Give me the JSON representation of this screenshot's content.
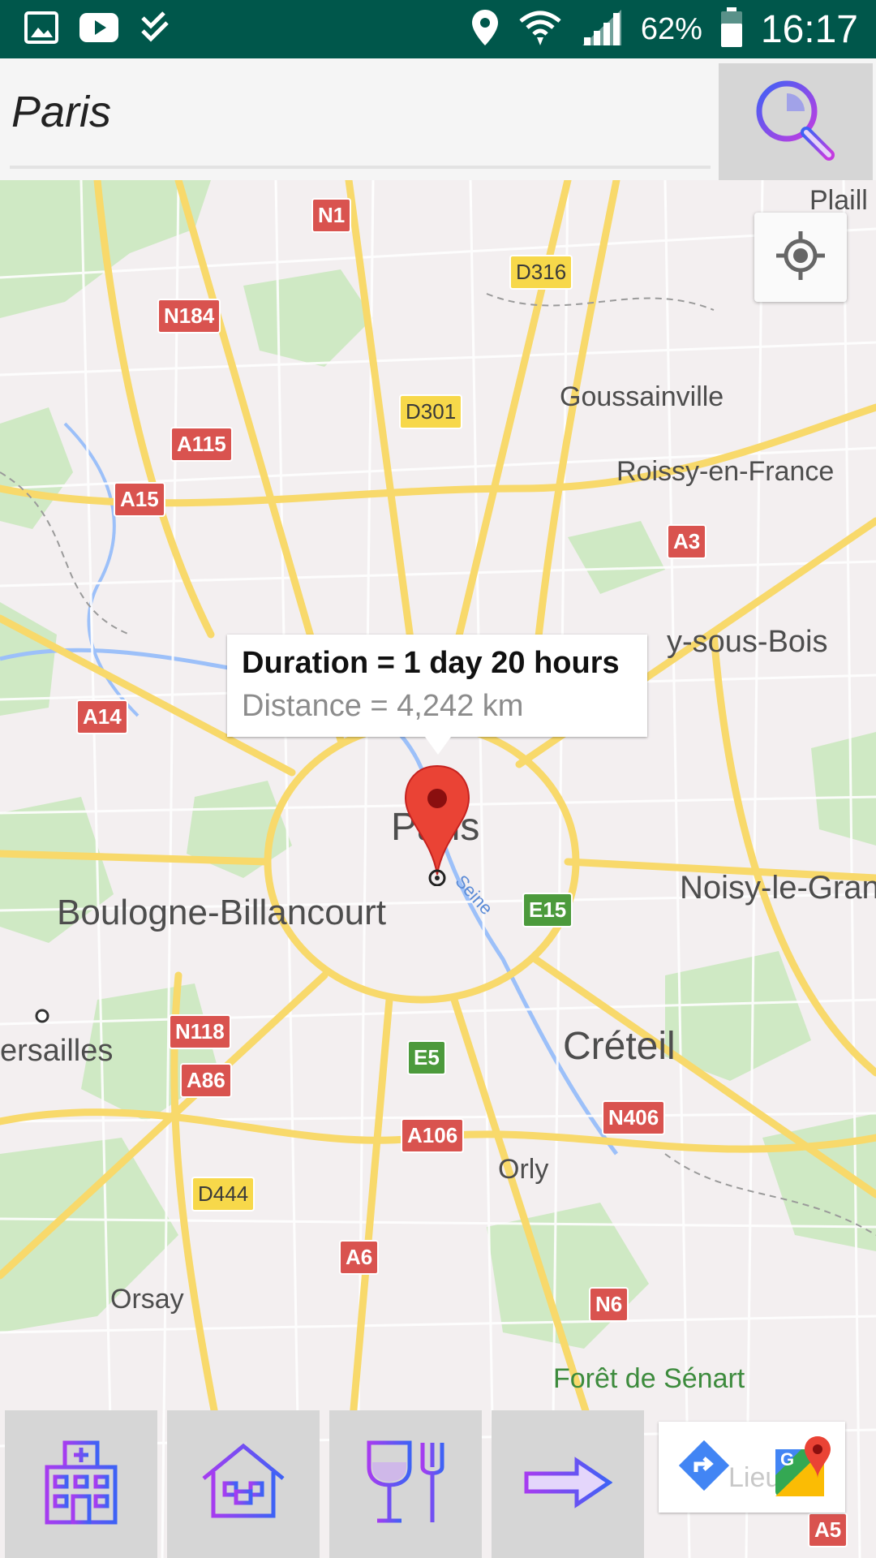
{
  "status_bar": {
    "battery": "62%",
    "time": "16:17",
    "icons": [
      "gallery-icon",
      "youtube-icon",
      "checklist-icon",
      "location-pin-icon",
      "wifi-icon",
      "signal-icon",
      "battery-icon"
    ]
  },
  "search": {
    "value": "Paris",
    "button_icon": "search-icon"
  },
  "map": {
    "places": {
      "paris": "Paris",
      "boulogne": "Boulogne-Billancourt",
      "versailles": "ersailles",
      "creteil": "Créteil",
      "noisy": "Noisy-le-Gran",
      "goussainville": "Goussainville",
      "roissy": "Roissy-en-France",
      "aulnay": "y-sous-Bois",
      "orly": "Orly",
      "orsay": "Orsay",
      "senart": "Forêt de Sénart",
      "plaill": "Plaill",
      "seine": "Seine"
    },
    "roads": {
      "n1": "N1",
      "d316": "D316",
      "n184": "N184",
      "d301": "D301",
      "a115": "A115",
      "a15": "A15",
      "a3": "A3",
      "a14": "A14",
      "e15": "E15",
      "n118": "N118",
      "a86": "A86",
      "e5": "E5",
      "n406": "N406",
      "a106": "A106",
      "d444": "D444",
      "a6": "A6",
      "n6": "N6",
      "a5": "A5"
    },
    "info_window": {
      "duration": "Duration = 1 day 20 hours",
      "distance": "Distance = 4,242 km"
    },
    "controls": {
      "locate_icon": "my-location-icon"
    }
  },
  "toolbar": {
    "buttons": [
      "hospital-icon",
      "hotel-icon",
      "restaurant-icon",
      "arrow-right-icon"
    ],
    "gmaps_ghost_text": "Lieu nt",
    "gmaps_icons": [
      "directions-icon",
      "google-maps-icon"
    ]
  },
  "colors": {
    "status_bar": "#00574b",
    "road_red": "#d9534f",
    "road_yellow": "#f7d84a",
    "road_green": "#4c9a3c",
    "marker": "#ea4335",
    "icon_gradient_start": "#a63cf0",
    "icon_gradient_end": "#3e62f5"
  }
}
